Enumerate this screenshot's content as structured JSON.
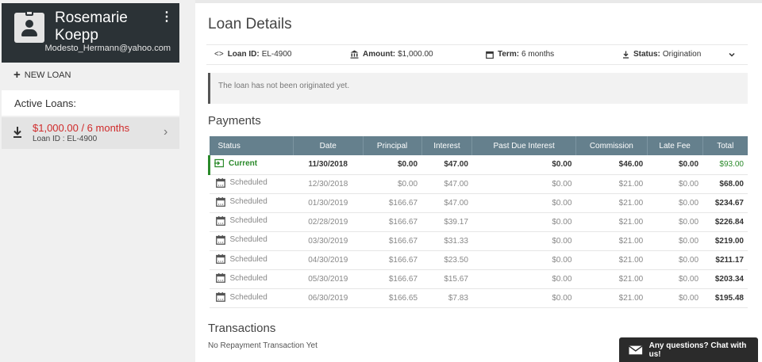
{
  "profile": {
    "name": "Rosemarie Koepp",
    "email": "Modesto_Hermann@yahoo.com"
  },
  "sidebar": {
    "new_loan_label": "NEW LOAN",
    "active_loans_label": "Active Loans:",
    "loans": [
      {
        "title": "$1,000.00 / 6 months",
        "id_label": "Loan ID : EL-4900"
      }
    ]
  },
  "main": {
    "title": "Loan Details",
    "info": {
      "loan_id_label": "Loan ID:",
      "loan_id": "EL-4900",
      "amount_label": "Amount:",
      "amount": "$1,000.00",
      "term_label": "Term:",
      "term": "6 months",
      "status_label": "Status:",
      "status": "Origination"
    },
    "notice": "The loan has not been originated yet.",
    "payments_title": "Payments",
    "payments_columns": [
      "Status",
      "Date",
      "Principal",
      "Interest",
      "Past Due Interest",
      "Commission",
      "Late Fee",
      "Total"
    ],
    "payments_rows": [
      {
        "status": "Current",
        "date": "11/30/2018",
        "principal": "$0.00",
        "interest": "$47.00",
        "past_due_interest": "$0.00",
        "commission": "$46.00",
        "late_fee": "$0.00",
        "total": "$93.00"
      },
      {
        "status": "Scheduled",
        "date": "12/30/2018",
        "principal": "$0.00",
        "interest": "$47.00",
        "past_due_interest": "$0.00",
        "commission": "$21.00",
        "late_fee": "$0.00",
        "total": "$68.00"
      },
      {
        "status": "Scheduled",
        "date": "01/30/2019",
        "principal": "$166.67",
        "interest": "$47.00",
        "past_due_interest": "$0.00",
        "commission": "$21.00",
        "late_fee": "$0.00",
        "total": "$234.67"
      },
      {
        "status": "Scheduled",
        "date": "02/28/2019",
        "principal": "$166.67",
        "interest": "$39.17",
        "past_due_interest": "$0.00",
        "commission": "$21.00",
        "late_fee": "$0.00",
        "total": "$226.84"
      },
      {
        "status": "Scheduled",
        "date": "03/30/2019",
        "principal": "$166.67",
        "interest": "$31.33",
        "past_due_interest": "$0.00",
        "commission": "$21.00",
        "late_fee": "$0.00",
        "total": "$219.00"
      },
      {
        "status": "Scheduled",
        "date": "04/30/2019",
        "principal": "$166.67",
        "interest": "$23.50",
        "past_due_interest": "$0.00",
        "commission": "$21.00",
        "late_fee": "$0.00",
        "total": "$211.17"
      },
      {
        "status": "Scheduled",
        "date": "05/30/2019",
        "principal": "$166.67",
        "interest": "$15.67",
        "past_due_interest": "$0.00",
        "commission": "$21.00",
        "late_fee": "$0.00",
        "total": "$203.34"
      },
      {
        "status": "Scheduled",
        "date": "06/30/2019",
        "principal": "$166.65",
        "interest": "$7.83",
        "past_due_interest": "$0.00",
        "commission": "$21.00",
        "late_fee": "$0.00",
        "total": "$195.48"
      }
    ],
    "transactions_title": "Transactions",
    "transactions_empty": "No Repayment Transaction Yet"
  },
  "chat": {
    "label": "Any questions? Chat with us!"
  },
  "icons": {
    "avatar": "contact-badge-icon",
    "menu": "more-vertical-icon",
    "new_loan": "plus-icon",
    "loan": "download-icon",
    "loan_open": "chevron-right-icon",
    "loan_id": "code-icon",
    "amount": "bank-icon",
    "term": "calendar-icon",
    "status": "download-icon",
    "expand": "chevron-down-icon",
    "current": "login-icon",
    "scheduled": "calendar-icon",
    "chat": "envelope-icon"
  },
  "colors": {
    "sidebar_dark": "#2b3236",
    "table_header": "#65808d",
    "loan_amount": "#d02a2a",
    "current_status": "#2b8a2b"
  }
}
